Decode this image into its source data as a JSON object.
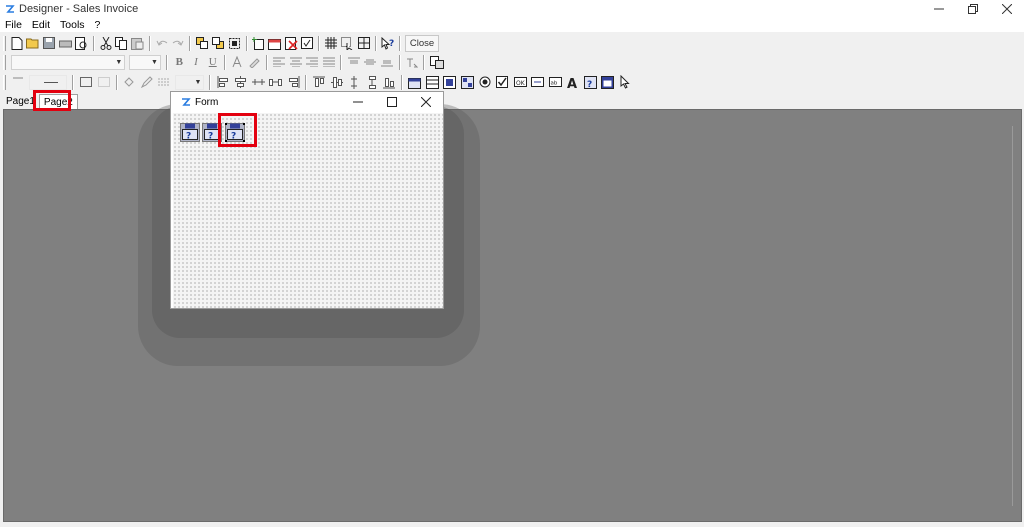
{
  "window": {
    "title": "Designer - Sales Invoice"
  },
  "menu": {
    "items": [
      "File",
      "Edit",
      "Tools",
      "?"
    ]
  },
  "toolbar": {
    "close_label": "Close"
  },
  "tabs": [
    {
      "label": "Page1"
    },
    {
      "label": "Page2"
    }
  ],
  "form": {
    "title": "Form",
    "field_icons": [
      "field-icon",
      "field-icon",
      "field-icon"
    ]
  },
  "colors": {
    "highlight": "#e3000f",
    "workspace": "#808080",
    "brand": "#2a7de1"
  }
}
